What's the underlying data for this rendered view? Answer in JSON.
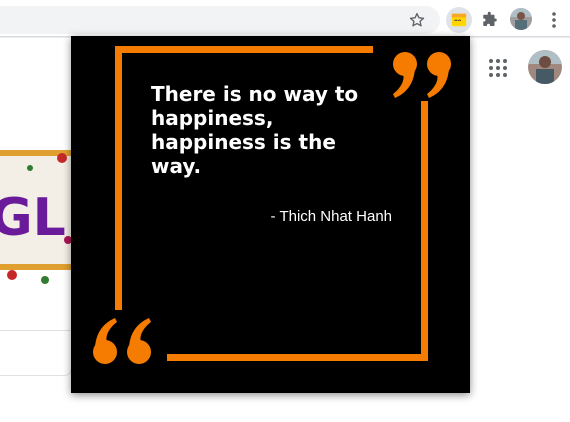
{
  "browser": {
    "toolbar_icons": [
      "star-icon",
      "quote-extension-icon",
      "puzzle-icon",
      "profile-avatar",
      "more-menu-icon"
    ],
    "accent_colors": {
      "toolbar_bg": "#ffffff",
      "omnibox_bg": "#f1f3f4"
    }
  },
  "page": {
    "icons": [
      "apps-grid-icon",
      "account-avatar",
      "google-doodle"
    ]
  },
  "popup": {
    "quote": "There is no way to happiness, happiness is the way.",
    "author": "- Thich Nhat Hanh",
    "colors": {
      "background": "#000000",
      "accent": "#f57c00",
      "text": "#ffffff"
    }
  }
}
